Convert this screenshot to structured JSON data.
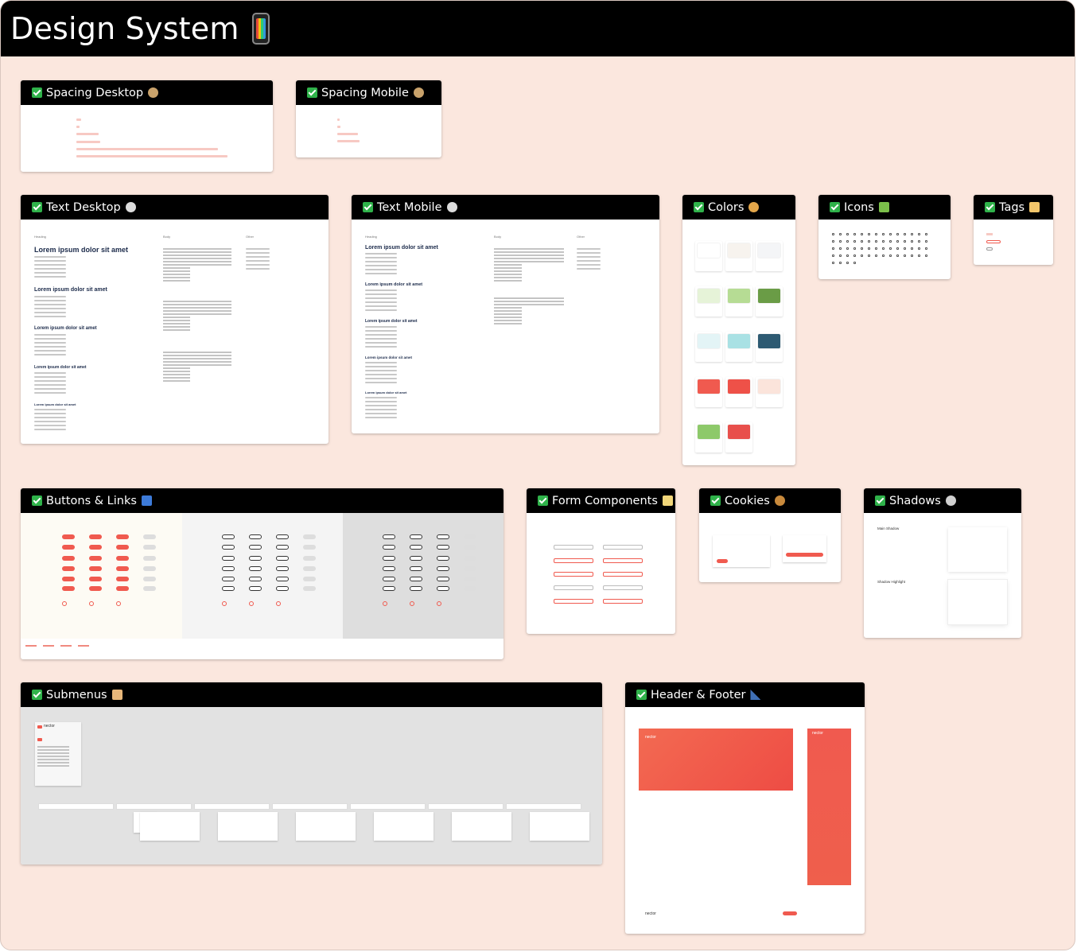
{
  "page": {
    "title": "Design System",
    "title_icon": "mobile-phone-icon"
  },
  "cards": {
    "spacing_desktop": {
      "title": "Spacing Desktop",
      "icon": "ringed-planet-icon"
    },
    "spacing_mobile": {
      "title": "Spacing Mobile",
      "icon": "ringed-planet-icon"
    },
    "text_desktop": {
      "title": "Text Desktop",
      "icon": "speech-bubble-icon",
      "col_heading": "Heading",
      "col_body": "Body",
      "col_other": "Other",
      "headings": [
        "Lorem ipsum dolor sit amet",
        "Lorem ipsum dolor sit amet",
        "Lorem ipsum dolor sit amet",
        "Lorem ipsum dolor sit amet",
        "Lorem ipsum dolor sit amet"
      ]
    },
    "text_mobile": {
      "title": "Text Mobile",
      "icon": "speech-bubble-icon",
      "col_heading": "Heading",
      "col_body": "Body",
      "col_other": "Other",
      "headings": [
        "Lorem ipsum dolor sit amet",
        "Lorem ipsum dolor sit amet",
        "Lorem ipsum dolor sit amet",
        "Lorem ipsum dolor sit amet",
        "Lorem ipsum dolor sit amet"
      ]
    },
    "colors": {
      "title": "Colors",
      "icon": "artist-palette-icon",
      "colors_list": [
        "#ffffff",
        "#f7f3ee",
        "#f4f5f7",
        "#e6f3d8",
        "#b6dc94",
        "#6a9c46",
        "#e3f4f6",
        "#a9e1e4",
        "#2d5a72",
        "#f05a4f",
        "#ee5148",
        "#fbe4db",
        "#8dc96a",
        "#e84f4b"
      ]
    },
    "icons": {
      "title": "Icons",
      "icon": "puzzle-piece-icon"
    },
    "tags": {
      "title": "Tags",
      "icon": "label-tag-icon"
    },
    "buttons": {
      "title": "Buttons & Links",
      "icon": "right-arrow-icon",
      "accent": "#f05a4f"
    },
    "forms": {
      "title": "Form Components",
      "icon": "memo-icon"
    },
    "cookies": {
      "title": "Cookies",
      "icon": "cookie-icon"
    },
    "shadows": {
      "title": "Shadows",
      "icon": "ghost-icon",
      "main": "Main Shadow",
      "highlight": "Shadow Highlight"
    },
    "submenus": {
      "title": "Submenus",
      "icon": "card-index-dividers-icon",
      "brand": "nector"
    },
    "header_footer": {
      "title": "Header & Footer",
      "icon": "triangular-ruler-icon",
      "brand": "nector"
    }
  }
}
